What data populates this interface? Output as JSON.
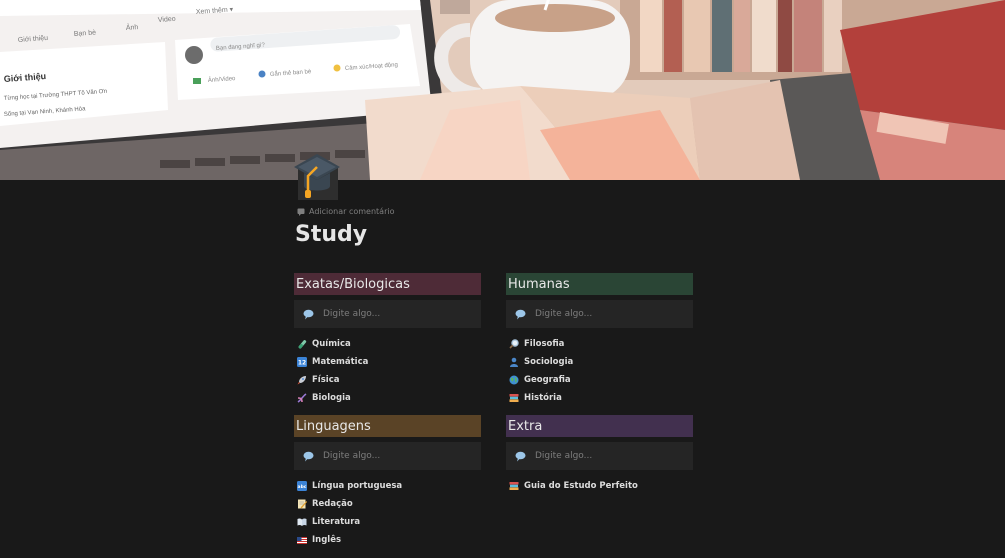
{
  "page": {
    "title": "Study",
    "add_comment_label": "Adicionar comentário",
    "page_icon": "graduation-cap-icon",
    "background": "#191919"
  },
  "cover": {
    "kind": "illustrated study desk: laptop with social feed, coffee mug, books, open notebook",
    "laptop_screen": {
      "nav_items": [
        "Giới thiệu",
        "Bạn bè",
        "Ảnh",
        "Video",
        "Xem thêm ▾"
      ],
      "intro_heading": "Giới thiệu",
      "intro_line_1": "Từng học tại Trường THPT Tô Văn Ơn",
      "intro_line_2": "Sống tại Vạn Ninh, Khánh Hòa",
      "post_placeholder": "Bạn đang nghĩ gì?",
      "actions": [
        "Ảnh/Video",
        "Gắn thẻ bạn bè",
        "Cảm xúc/Hoạt động"
      ]
    }
  },
  "sections": [
    {
      "id": "exatas",
      "title": "Exatas/Biologicas",
      "color": "#4e2b37",
      "placeholder": "Digite algo...",
      "items": [
        {
          "label": "Química",
          "icon": "test-tube-icon"
        },
        {
          "label": "Matemática",
          "icon": "numbers-icon"
        },
        {
          "label": "Física",
          "icon": "rocket-icon"
        },
        {
          "label": "Biologia",
          "icon": "dna-icon"
        }
      ]
    },
    {
      "id": "humanas",
      "title": "Humanas",
      "color": "#2a4535",
      "placeholder": "Digite algo...",
      "items": [
        {
          "label": "Filosofia",
          "icon": "magnifier-icon"
        },
        {
          "label": "Sociologia",
          "icon": "person-icon"
        },
        {
          "label": "Geografia",
          "icon": "globe-icon"
        },
        {
          "label": "História",
          "icon": "books-icon"
        }
      ]
    },
    {
      "id": "linguagens",
      "title": "Linguagens",
      "color": "#5a4326",
      "placeholder": "Digite algo...",
      "items": [
        {
          "label": "Língua portuguesa",
          "icon": "abc-icon"
        },
        {
          "label": "Redação",
          "icon": "memo-icon"
        },
        {
          "label": "Literatura",
          "icon": "open-book-icon"
        },
        {
          "label": "Inglês",
          "icon": "us-flag-icon"
        }
      ]
    },
    {
      "id": "extra",
      "title": "Extra",
      "color": "#42304f",
      "placeholder": "Digite algo...",
      "items": [
        {
          "label": "Guia do Estudo Perfeito",
          "icon": "books-icon"
        }
      ]
    }
  ]
}
